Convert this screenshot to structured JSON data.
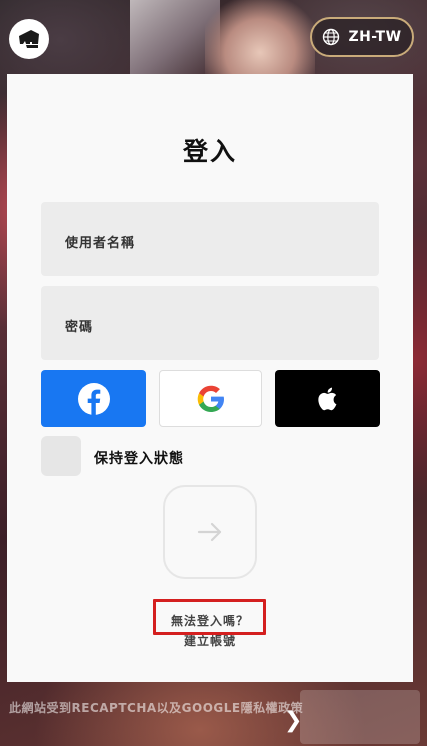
{
  "header": {
    "language": "ZH-TW"
  },
  "login": {
    "title": "登入",
    "username_label": "使用者名稱",
    "password_label": "密碼",
    "keep_signed_in": "保持登入狀態",
    "cant_sign_in": "無法登入嗎？",
    "create_account": "建立帳號"
  },
  "social": [
    "facebook-icon",
    "google-icon",
    "apple-icon"
  ],
  "footer": {
    "recaptcha_text": "此網站受到RECAPTCHA以及GOOGLE隱私權政策",
    "chevron": "❯"
  },
  "colors": {
    "facebook": "#1877f2",
    "apple": "#000000",
    "highlight": "#d41f1f",
    "lang_border": "#c9ab7a"
  }
}
